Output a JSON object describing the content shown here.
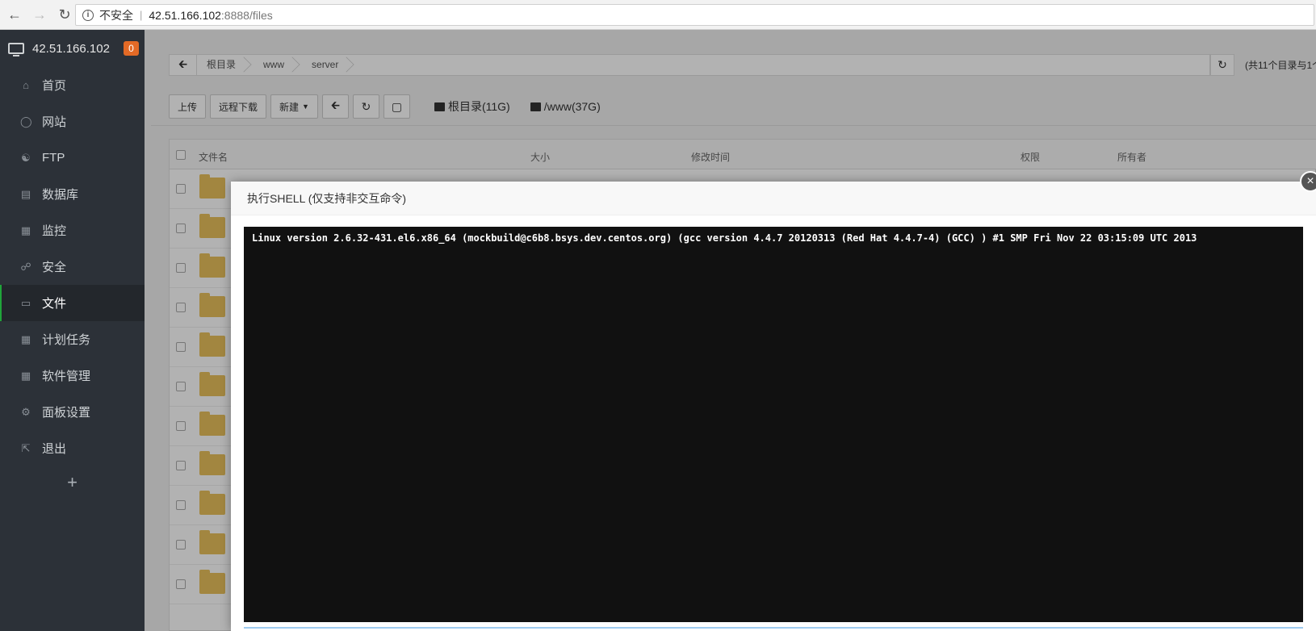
{
  "browser": {
    "insecure_label": "不安全",
    "url_host": "42.51.166.102",
    "url_rest": ":8888/files"
  },
  "sidebar": {
    "server_ip": "42.51.166.102",
    "badge_count": "0",
    "items": [
      {
        "label": "首页",
        "icon": "home-icon"
      },
      {
        "label": "网站",
        "icon": "globe-icon"
      },
      {
        "label": "FTP",
        "icon": "ftp-icon"
      },
      {
        "label": "数据库",
        "icon": "database-icon"
      },
      {
        "label": "监控",
        "icon": "monitor-chart-icon"
      },
      {
        "label": "安全",
        "icon": "shield-icon"
      },
      {
        "label": "文件",
        "icon": "folder-icon",
        "active": true
      },
      {
        "label": "计划任务",
        "icon": "calendar-icon"
      },
      {
        "label": "软件管理",
        "icon": "apps-icon"
      },
      {
        "label": "面板设置",
        "icon": "gear-icon"
      },
      {
        "label": "退出",
        "icon": "logout-icon"
      }
    ],
    "add_symbol": "+"
  },
  "breadcrumb": {
    "items": [
      "根目录",
      "www",
      "server"
    ],
    "summary": "(共11个目录与1个"
  },
  "toolbar": {
    "upload": "上传",
    "remote_download": "远程下载",
    "new": "新建",
    "disk_root": "根目录(11G)",
    "disk_www": "/www(37G)"
  },
  "table": {
    "col_name": "文件名",
    "col_size": "大小",
    "col_mtime": "修改时间",
    "col_perm": "权限",
    "col_owner": "所有者"
  },
  "modal": {
    "title": "执行SHELL (仅支持非交互命令)",
    "output": "Linux version 2.6.32-431.el6.x86_64 (mockbuild@c6b8.bsys.dev.centos.org) (gcc version 4.4.7 20120313 (Red Hat 4.4.7-4) (GCC) ) #1 SMP Fri Nov 22 03:15:09 UTC 2013"
  }
}
